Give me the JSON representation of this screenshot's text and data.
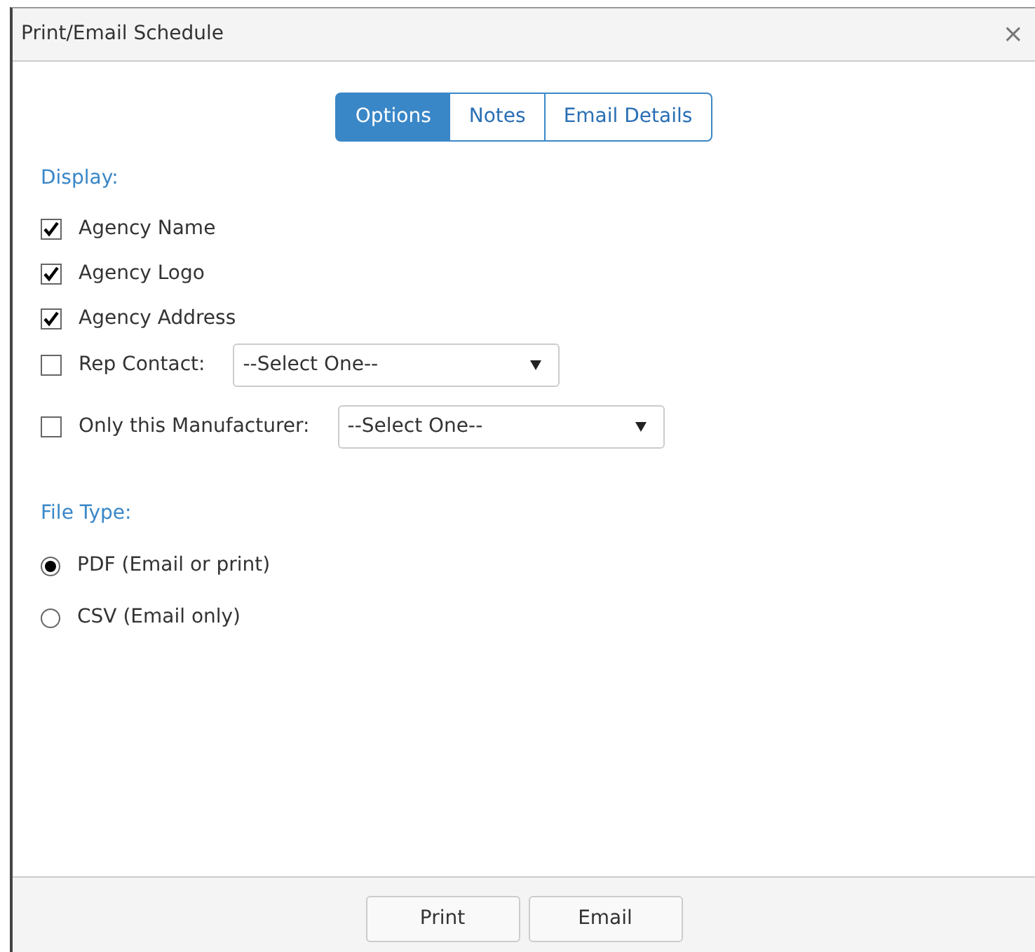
{
  "window": {
    "title": "Print/Email Schedule",
    "close": "×"
  },
  "tabs": [
    {
      "label": "Options",
      "selected": true
    },
    {
      "label": "Notes",
      "selected": false
    },
    {
      "label": "Email Details",
      "selected": false
    }
  ],
  "display": {
    "heading": "Display:",
    "options": [
      {
        "kind": "checkbox",
        "label": "Agency Name",
        "checked": true
      },
      {
        "kind": "checkbox",
        "label": "Agency Logo",
        "checked": true
      },
      {
        "kind": "checkbox",
        "label": "Agency Address",
        "checked": true
      },
      {
        "kind": "select",
        "label": "Rep Contact:",
        "checked": false,
        "value": "--Select One--"
      },
      {
        "kind": "select",
        "label": "Only this Manufacturer:",
        "checked": false,
        "value": "--Select One--"
      }
    ]
  },
  "file_type": {
    "heading": "File Type:",
    "options": [
      {
        "label": "PDF (Email or print)",
        "selected": true
      },
      {
        "label": "CSV (Email only)",
        "selected": false
      }
    ]
  },
  "buttons": [
    "Print",
    "Email"
  ]
}
